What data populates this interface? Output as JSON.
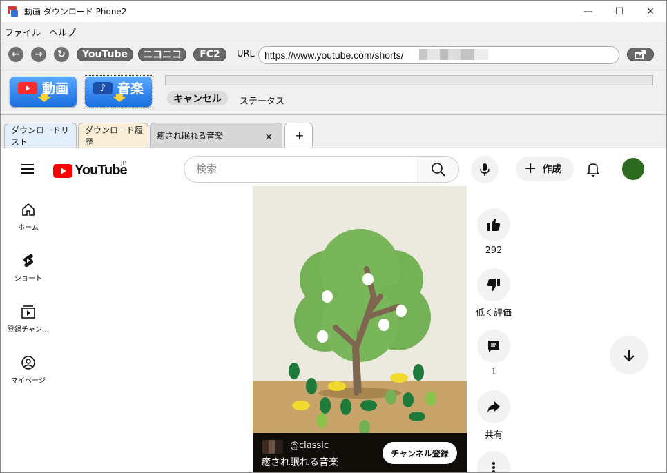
{
  "window": {
    "title": "動画 ダウンロード Phone2",
    "minimize": "—",
    "maximize": "☐",
    "close": "✕"
  },
  "menu": [
    "ファイル",
    "ヘルプ"
  ],
  "toolbar": {
    "back": "←",
    "forward": "→",
    "reload": "↻",
    "site_buttons": [
      "YouTube",
      "ニコニコ",
      "FC2"
    ],
    "url_label": "URL",
    "url_value": "https://www.youtube.com/shorts/"
  },
  "download": {
    "video_button": "動画",
    "music_button": "音楽",
    "cancel_button": "キャンセル",
    "status_label": "ステータス",
    "progress": 0
  },
  "tabs": [
    {
      "label": "ダウンロードリスト"
    },
    {
      "label": "ダウンロード履歴"
    },
    {
      "label": "癒され眠れる音楽",
      "close": "×"
    }
  ],
  "new_tab": "+",
  "youtube": {
    "logo_text": "YouTube",
    "region": "JP",
    "search_placeholder": "検索",
    "create_label": "作成",
    "sidebar": [
      {
        "label": "ホーム",
        "icon": "home-icon"
      },
      {
        "label": "ショート",
        "icon": "shorts-icon"
      },
      {
        "label": "登録チャン…",
        "icon": "subscriptions-icon"
      },
      {
        "label": "マイページ",
        "icon": "profile-icon"
      }
    ],
    "video": {
      "channel": "@classic",
      "title": "癒され眠れる音楽",
      "subscribe": "チャンネル登録"
    },
    "actions": {
      "likes": "292",
      "dislike": "低く評価",
      "comments": "1",
      "share": "共有"
    }
  },
  "colors": {
    "yt_red": "#ff0000",
    "accent_blue": "#1a6fe0",
    "avatar_green": "#2c6a1f",
    "tab_list": "#e3eefb",
    "tab_history": "#fbeed6",
    "tab_active": "#d7d7d7"
  }
}
